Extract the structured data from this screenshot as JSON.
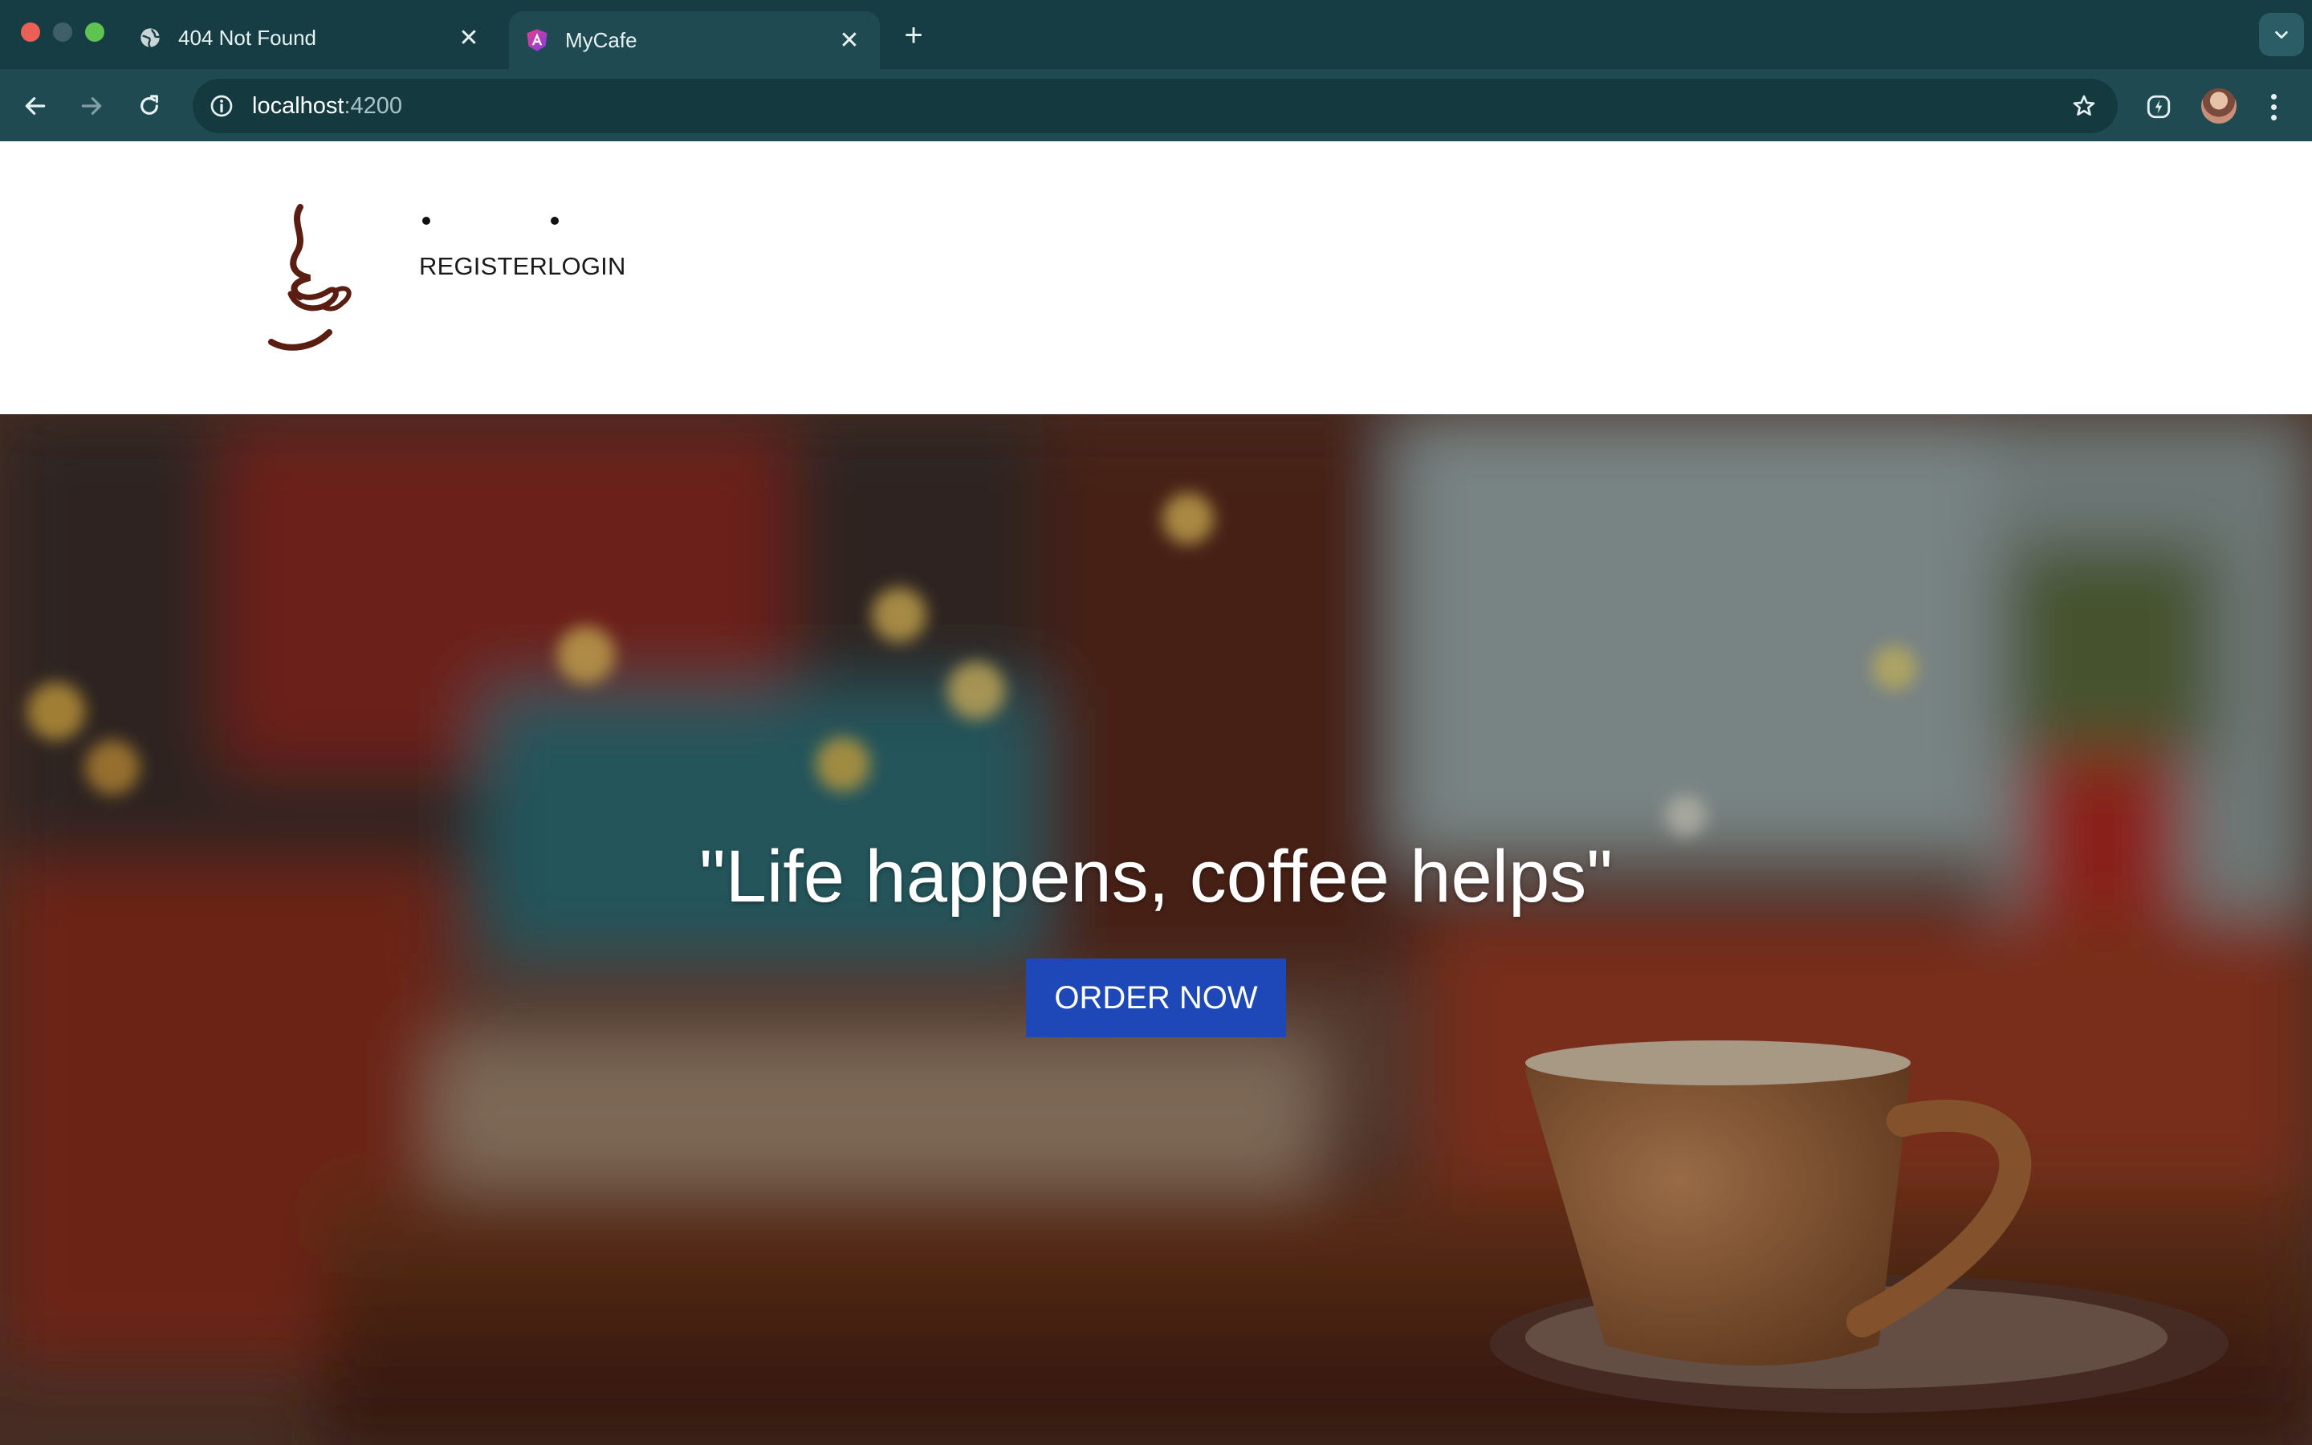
{
  "browser": {
    "tabs": [
      {
        "title": "404 Not Found",
        "icon": "globe-icon",
        "active": false
      },
      {
        "title": "MyCafe",
        "icon": "angular-icon",
        "active": true
      }
    ],
    "url_host": "localhost",
    "url_port": ":4200"
  },
  "site": {
    "logo_icon": "coffee-cup-logo-icon",
    "nav": [
      {
        "label": "REGISTER"
      },
      {
        "label": "LOGIN"
      }
    ]
  },
  "hero": {
    "quote": "\"Life happens, coffee helps\"",
    "cta_label": "ORDER NOW",
    "cta_color": "#1e48b8"
  }
}
